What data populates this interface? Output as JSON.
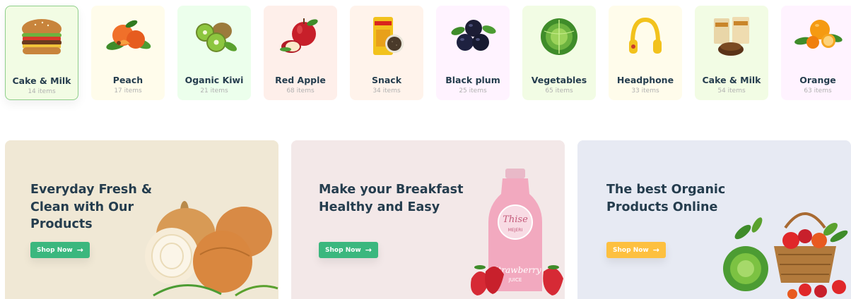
{
  "categories": [
    {
      "name": "Cake & Milk",
      "count": "14 items",
      "bg": "#f2fce4",
      "icon": "burger-icon"
    },
    {
      "name": "Peach",
      "count": "17 items",
      "bg": "#fffceb",
      "icon": "peach-icon"
    },
    {
      "name": "Oganic Kiwi",
      "count": "21 items",
      "bg": "#ecffec",
      "icon": "kiwi-icon"
    },
    {
      "name": "Red Apple",
      "count": "68 items",
      "bg": "#feefea",
      "icon": "apple-icon"
    },
    {
      "name": "Snack",
      "count": "34 items",
      "bg": "#fff3eb",
      "icon": "snack-bag-icon"
    },
    {
      "name": "Black plum",
      "count": "25 items",
      "bg": "#fff3ff",
      "icon": "plum-icon"
    },
    {
      "name": "Vegetables",
      "count": "65 items",
      "bg": "#f2fce4",
      "icon": "cabbage-icon"
    },
    {
      "name": "Headphone",
      "count": "33 items",
      "bg": "#fffceb",
      "icon": "headphone-icon"
    },
    {
      "name": "Cake & Milk",
      "count": "54 items",
      "bg": "#f2fce4",
      "icon": "cake-pack-icon"
    },
    {
      "name": "Orange",
      "count": "63 items",
      "bg": "#fff3ff",
      "icon": "orange-icon"
    }
  ],
  "banners": [
    {
      "title": "Everyday Fresh & Clean with Our Products",
      "button": "Shop Now",
      "bg": "#f0e8d5",
      "button_color": "#3bb77e",
      "art": "onion-icon"
    },
    {
      "title": "Make your Breakfast Healthy and Easy",
      "button": "Shop Now",
      "bg": "#f3e8e8",
      "button_color": "#3bb77e",
      "art": "milk-bottle-icon"
    },
    {
      "title": "The best Organic Products Online",
      "button": "Shop Now",
      "bg": "#e7eaf3",
      "button_color": "#fdc040",
      "art": "vegetable-basket-icon"
    }
  ],
  "art_text": {
    "bottle_brand": "Thise",
    "bottle_sub": "MEJERI",
    "bottle_flavor": "Strawberry",
    "bottle_juice": "JUICE"
  }
}
